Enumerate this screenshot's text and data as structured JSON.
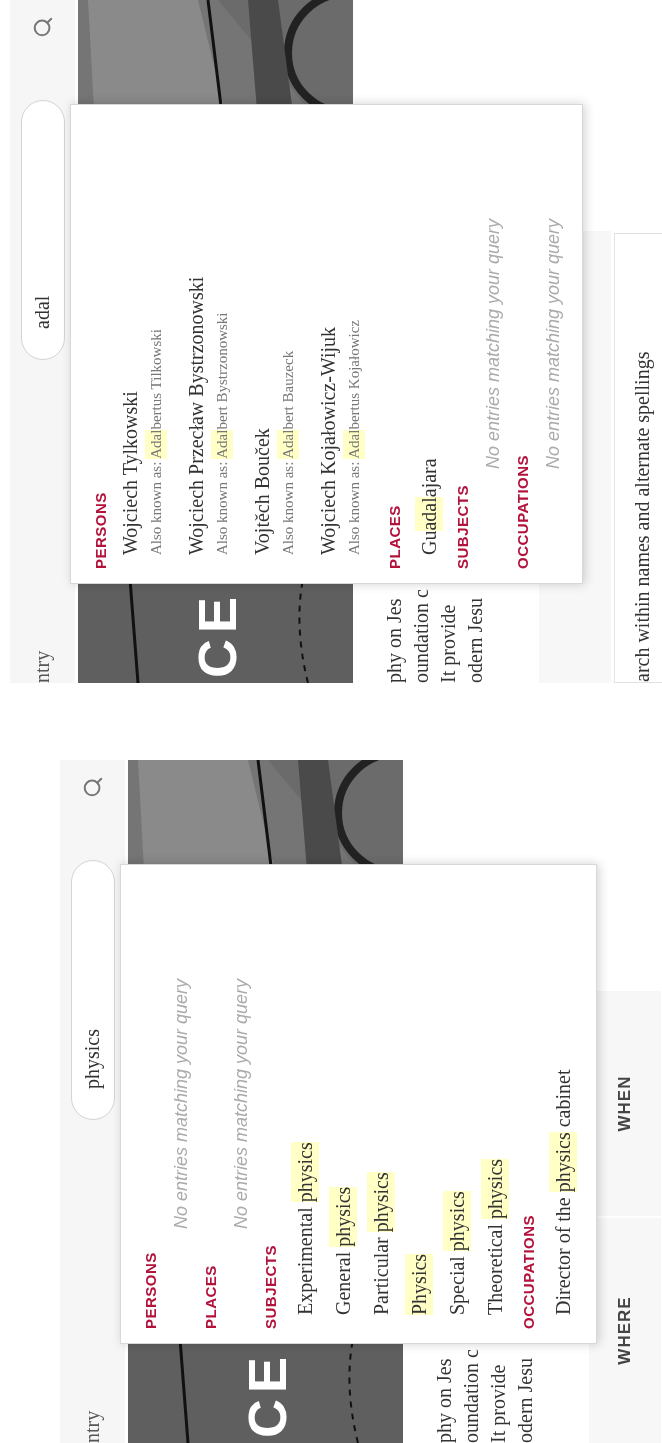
{
  "panels": [
    {
      "header": {
        "title": "ntry",
        "search": {
          "value": "physics"
        }
      },
      "hero": {
        "kind": "picture",
        "title": "CE"
      },
      "intro_lines": [
        "phy on Jes",
        "oundation c",
        "It provide",
        "odern Jesu"
      ],
      "tabs": [
        {
          "label": "WHERE"
        },
        {
          "label": "WHEN"
        }
      ],
      "dropdown": {
        "sections": [
          {
            "heading": "PERSONS",
            "empty_message": "No entries matching your query"
          },
          {
            "heading": "PLACES",
            "empty_message": "No entries matching your query"
          },
          {
            "heading": "SUBJECTS",
            "items": [
              {
                "name": [
                  {
                    "text": "Experimental ",
                    "highlight": false
                  },
                  {
                    "text": "physics",
                    "highlight": true
                  }
                ]
              },
              {
                "name": [
                  {
                    "text": "General ",
                    "highlight": false
                  },
                  {
                    "text": "physics",
                    "highlight": true
                  }
                ]
              },
              {
                "name": [
                  {
                    "text": "Particular ",
                    "highlight": false
                  },
                  {
                    "text": "physics",
                    "highlight": true
                  }
                ]
              },
              {
                "name": [
                  {
                    "text": "Physics",
                    "highlight": true
                  }
                ]
              },
              {
                "name": [
                  {
                    "text": "Special ",
                    "highlight": false
                  },
                  {
                    "text": "physics",
                    "highlight": true
                  }
                ]
              },
              {
                "name": [
                  {
                    "text": "Theoretical ",
                    "highlight": false
                  },
                  {
                    "text": "physics",
                    "highlight": true
                  }
                ]
              }
            ]
          },
          {
            "heading": "OCCUPATIONS",
            "items": [
              {
                "name": [
                  {
                    "text": "Director of the ",
                    "highlight": false
                  },
                  {
                    "text": "physics",
                    "highlight": true
                  },
                  {
                    "text": " cabinet",
                    "highlight": false
                  }
                ]
              }
            ]
          }
        ]
      }
    },
    {
      "header": {
        "title": "ntry",
        "search": {
          "value": "adal"
        }
      },
      "hero": {
        "kind": "picture",
        "title": "CE"
      },
      "intro_lines": [
        "phy on Jes",
        "oundation c",
        "It provide",
        "odern Jesu"
      ],
      "search_note": "arch within names and alternate spellings",
      "dropdown": {
        "sections": [
          {
            "heading": "PERSONS",
            "items": [
              {
                "name": [
                  {
                    "text": "Wojciech Tylkowski",
                    "highlight": false
                  }
                ],
                "aka": [
                  {
                    "text": "Also known as: ",
                    "highlight": false
                  },
                  {
                    "text": "Adal",
                    "highlight": true
                  },
                  {
                    "text": "bertus Tilkowski",
                    "highlight": false
                  }
                ]
              },
              {
                "name": [
                  {
                    "text": "Wojciech Przecław Bystrzonowski",
                    "highlight": false
                  }
                ],
                "aka": [
                  {
                    "text": "Also known as: ",
                    "highlight": false
                  },
                  {
                    "text": "Adal",
                    "highlight": true
                  },
                  {
                    "text": "bert Bystrzonowski",
                    "highlight": false
                  }
                ]
              },
              {
                "name": [
                  {
                    "text": "Vojtěch Bouček",
                    "highlight": false
                  }
                ],
                "aka": [
                  {
                    "text": "Also known as: ",
                    "highlight": false
                  },
                  {
                    "text": "Adal",
                    "highlight": true
                  },
                  {
                    "text": "bert Bauzeck",
                    "highlight": false
                  }
                ]
              },
              {
                "name": [
                  {
                    "text": "Wojciech Kojałowicz-Wijuk",
                    "highlight": false
                  }
                ],
                "aka": [
                  {
                    "text": "Also known as: ",
                    "highlight": false
                  },
                  {
                    "text": "Adal",
                    "highlight": true
                  },
                  {
                    "text": "bertus Kojałowicz",
                    "highlight": false
                  }
                ]
              }
            ]
          },
          {
            "heading": "PLACES",
            "items": [
              {
                "name": [
                  {
                    "text": "Gu",
                    "highlight": false
                  },
                  {
                    "text": "adal",
                    "highlight": true
                  },
                  {
                    "text": "ajara",
                    "highlight": false
                  }
                ]
              }
            ]
          },
          {
            "heading": "SUBJECTS",
            "empty_message": "No entries matching your query"
          },
          {
            "heading": "OCCUPATIONS",
            "empty_message": "No entries matching your query"
          }
        ]
      }
    }
  ]
}
